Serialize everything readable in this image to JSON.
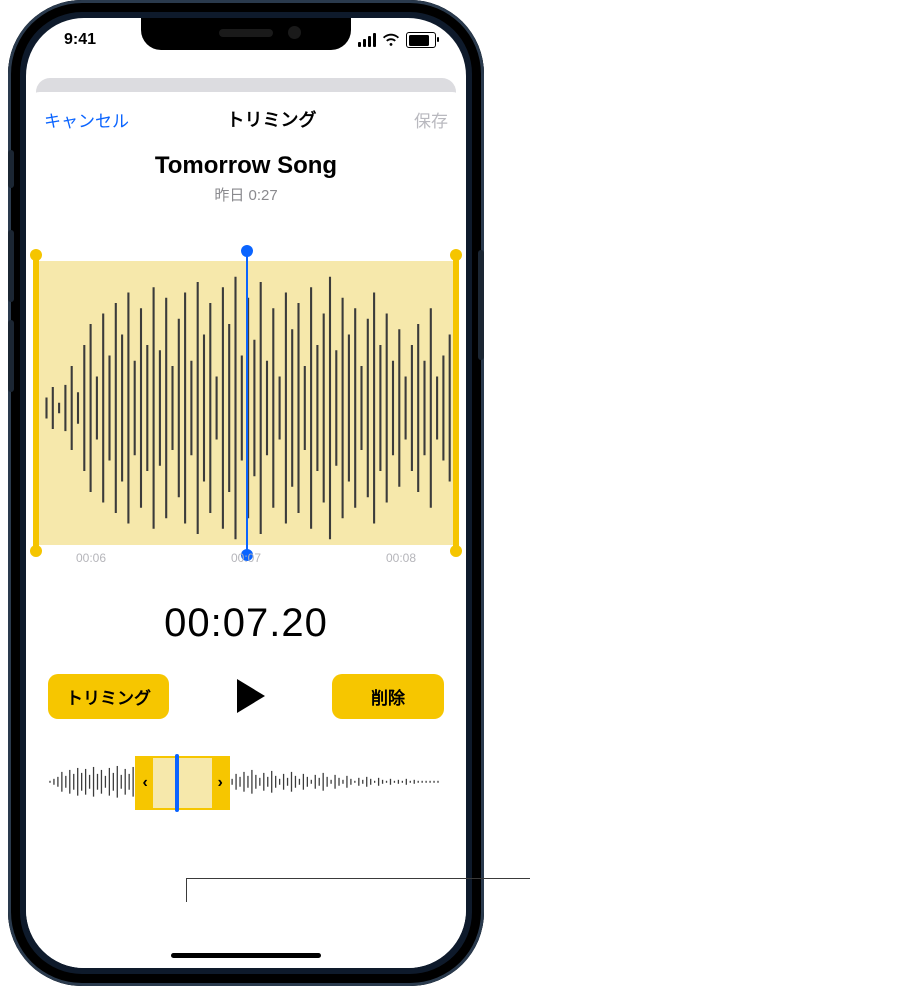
{
  "status": {
    "time": "9:41"
  },
  "nav": {
    "cancel": "キャンセル",
    "title": "トリミング",
    "save": "保存"
  },
  "recording": {
    "title": "Tomorrow Song",
    "subtitle": "昨日  0:27"
  },
  "waveform": {
    "ticks": [
      "00:06",
      "00:07",
      "00:08"
    ],
    "playhead_percent": 50,
    "sel_start_percent": 0,
    "sel_end_percent": 100
  },
  "timecode": "00:07.20",
  "buttons": {
    "trim": "トリミング",
    "delete": "削除",
    "play_icon": "play-icon"
  },
  "overview": {
    "sel_start_percent": 22,
    "sel_end_percent": 46,
    "playhead_percent": 32
  },
  "colors": {
    "accent_blue": "#0a64ff",
    "accent_yellow": "#f6c600",
    "selection_fill": "#f6e8ab",
    "disabled": "#b9b9bf"
  }
}
